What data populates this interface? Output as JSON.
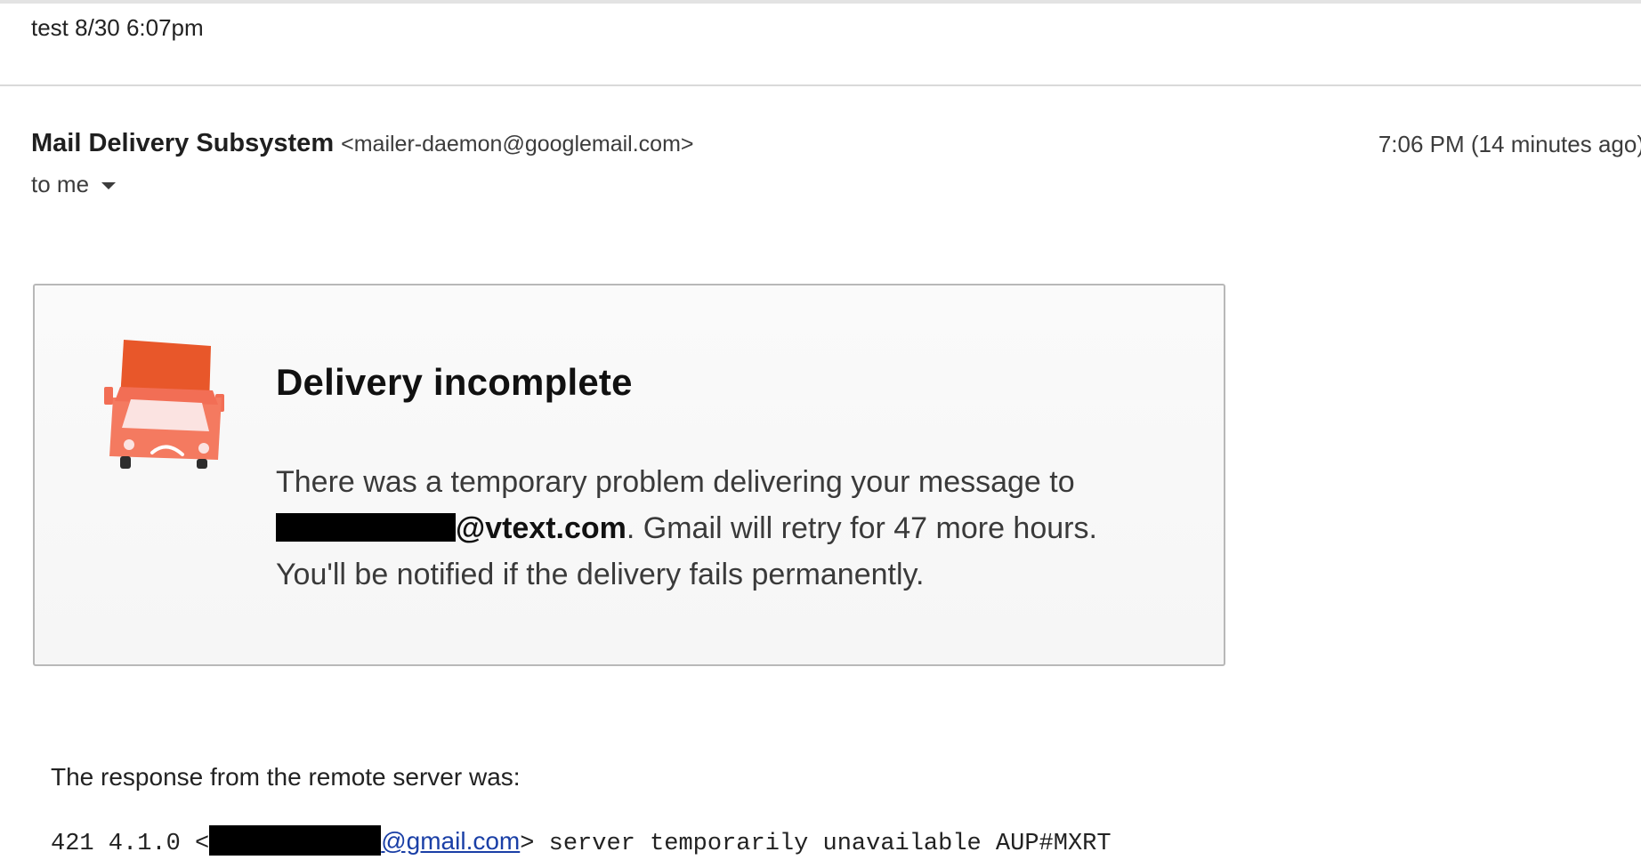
{
  "email": {
    "subject": "test 8/30 6:07pm",
    "sender": {
      "name": "Mail Delivery Subsystem",
      "email": "<mailer-daemon@googlemail.com>"
    },
    "timestamp": "7:06 PM (14 minutes ago)",
    "recipient_label": "to me",
    "card": {
      "title": "Delivery incomplete",
      "body_line1": "There was a temporary problem delivering your message to",
      "address_domain": "@vtext.com",
      "body_line2_rest": ". Gmail will retry for 47 more hours.",
      "body_line3": "You'll be notified if the delivery fails permanently."
    },
    "response": {
      "label": "The response from the remote server was:",
      "code_prefix": "421 4.1.0 <",
      "email_domain": "@gmail.com",
      "code_suffix": "> server temporarily unavailable AUP#MXRT"
    }
  },
  "icons": {
    "truck": "sad-delivery-truck-icon",
    "dropdown": "caret-down-icon"
  },
  "colors": {
    "truck_top": "#e8572a",
    "truck_body": "#f26e55",
    "truck_window": "#fde8e6",
    "link": "#1a3fa6"
  }
}
